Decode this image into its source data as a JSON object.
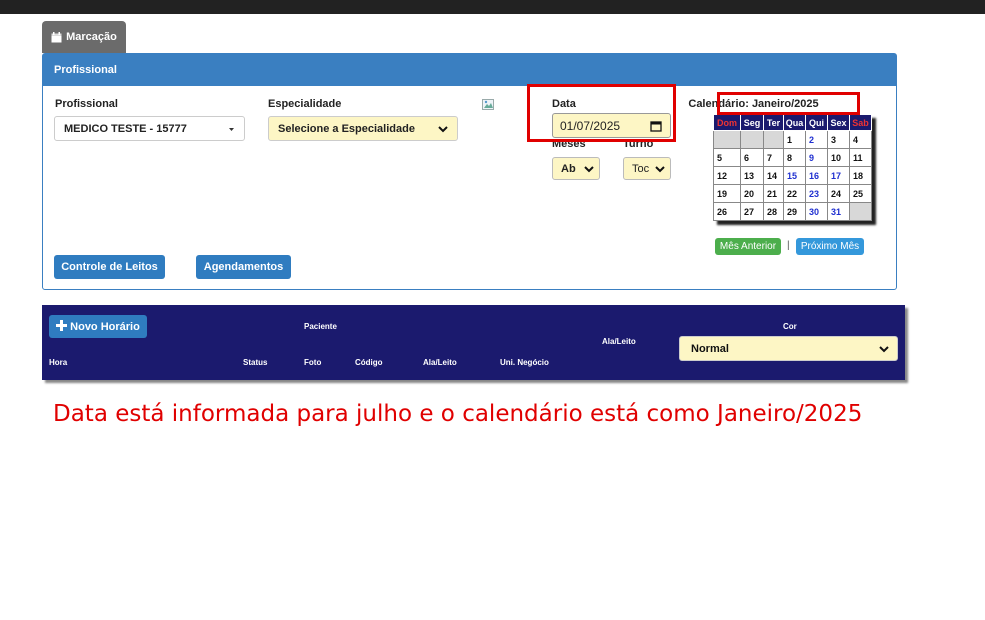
{
  "tab": {
    "label": "Marcação"
  },
  "panel": {
    "title": "Profissional"
  },
  "form": {
    "profissional_label": "Profissional",
    "profissional_value": "MEDICO TESTE - 15777",
    "especialidade_label": "Especialidade",
    "especialidade_value": "Selecione a Especialidade",
    "data_label": "Data",
    "data_value": "01/07/2025",
    "meses_label": "Meses",
    "meses_value": "Ab",
    "turno_label": "Turno",
    "turno_value": "Toc"
  },
  "calendar": {
    "title": "Calendário: Janeiro/2025",
    "weekdays": [
      "Dom",
      "Seg",
      "Ter",
      "Qua",
      "Qui",
      "Sex",
      "Sab"
    ],
    "weeks": [
      [
        "",
        "",
        "",
        "1",
        "2",
        "3",
        "4"
      ],
      [
        "5",
        "6",
        "7",
        "8",
        "9",
        "10",
        "11"
      ],
      [
        "12",
        "13",
        "14",
        "15",
        "16",
        "17",
        "18"
      ],
      [
        "19",
        "20",
        "21",
        "22",
        "23",
        "24",
        "25"
      ],
      [
        "26",
        "27",
        "28",
        "29",
        "30",
        "31",
        ""
      ]
    ],
    "prev_label": "Mês Anterior",
    "next_label": "Próximo Mês"
  },
  "buttons": {
    "controle_leitos": "Controle de Leitos",
    "agendamentos": "Agendamentos"
  },
  "schedule": {
    "novo_label": "Novo Horário",
    "headers": {
      "paciente": "Paciente",
      "ala_leito_top": "Ala/Leito",
      "cor": "Cor",
      "hora": "Hora",
      "status": "Status",
      "foto": "Foto",
      "codigo": "Código",
      "ala_leito": "Ala/Leito",
      "uni_negocio": "Uni. Negócio"
    },
    "cor_value": "Normal"
  },
  "annotation": "Data está informada para julho e o calendário está como Janeiro/2025",
  "colors": {
    "header_blue": "#3a7fc1",
    "navy": "#1b1a6e",
    "highlight_red": "#e00000",
    "input_yellow": "#fdf6c5"
  }
}
